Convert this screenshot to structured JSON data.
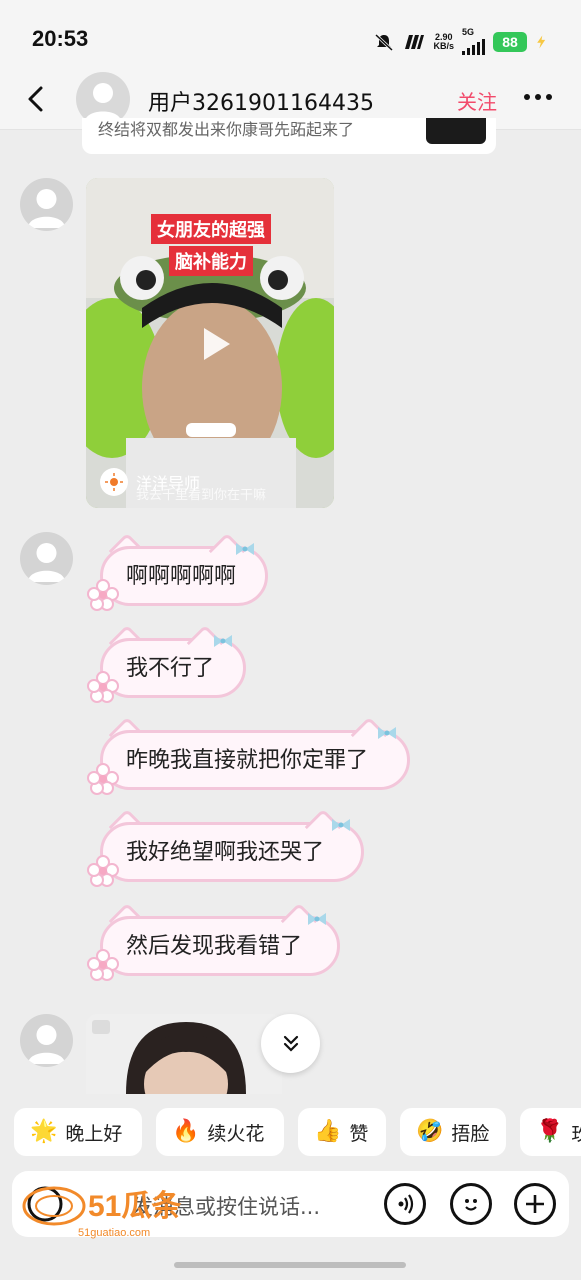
{
  "status": {
    "time": "20:53",
    "net_speed_value": "2.90",
    "net_speed_unit": "KB/s",
    "network": "5G",
    "battery": "88",
    "icons": [
      "mute-bell-icon",
      "nfc-icon",
      "signal-icon",
      "battery-icon",
      "charging-icon"
    ]
  },
  "header": {
    "username": "用户3261901164435",
    "follow_label": "关注",
    "back_icon": "chevron-left-icon",
    "more_icon": "more-dots-icon"
  },
  "partial_card": {
    "text": "终结将双都发出来你康哥先跖起来了"
  },
  "messages": [
    {
      "type": "video",
      "title_line1": "女朋友的超强",
      "title_line2": "脑补能力",
      "author": "洋洋导师",
      "caption": "我去千里看到你在干嘛"
    },
    {
      "type": "text",
      "text": "啊啊啊啊啊"
    },
    {
      "type": "text",
      "text": "我不行了"
    },
    {
      "type": "text",
      "text": "昨晚我直接就把你定罪了"
    },
    {
      "type": "text",
      "text": "我好绝望啊我还哭了"
    },
    {
      "type": "text",
      "text": "然后发现我看错了"
    },
    {
      "type": "video",
      "partial": true
    }
  ],
  "quick_replies": [
    {
      "emoji": "🌟",
      "label": "晚上好"
    },
    {
      "emoji": "🔥",
      "label": "续火花"
    },
    {
      "emoji": "👍",
      "label": "赞"
    },
    {
      "emoji": "🤣",
      "label": "捂脸"
    },
    {
      "emoji": "🌹",
      "label": "玫"
    }
  ],
  "input": {
    "placeholder": "发消息或按住说话...",
    "icons": [
      "voice-icon",
      "emoji-icon",
      "plus-icon"
    ]
  },
  "watermark": {
    "brand": "51瓜条",
    "url": "51guatiao.com"
  },
  "colors": {
    "accent": "#f24a6b",
    "bubble_border": "#f3c6da",
    "bubble_fill": "#fff5fa",
    "battery": "#34c759"
  }
}
